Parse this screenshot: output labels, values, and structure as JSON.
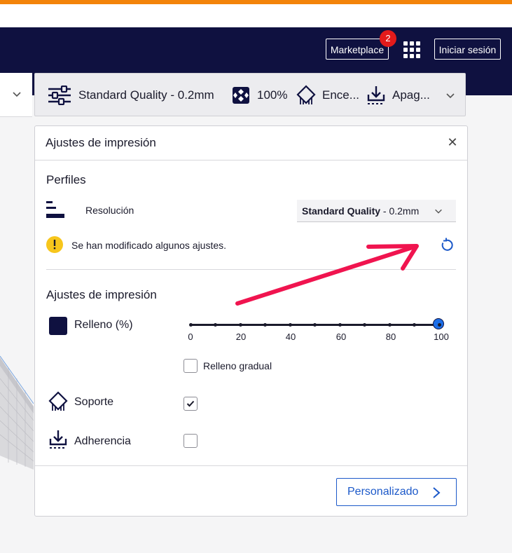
{
  "header": {
    "marketplace_label": "Marketplace",
    "marketplace_badge": "2",
    "signin_label": "Iniciar sesión"
  },
  "toolbar": {
    "profile": "Standard Quality - 0.2mm",
    "infill": "100%",
    "support": "Ence...",
    "adhesion": "Apag..."
  },
  "panel": {
    "title": "Ajustes de impresión",
    "profiles_title": "Perfiles",
    "resolution_label": "Resolución",
    "resolution_value_bold": "Standard Quality",
    "resolution_value_rest": " - 0.2mm",
    "warning_text": "Se han modificado algunos ajustes.",
    "print_settings_title": "Ajustes de impresión",
    "infill_label": "Relleno (%)",
    "infill_value": 100,
    "infill_ticks": [
      "0",
      "20",
      "40",
      "60",
      "80",
      "100"
    ],
    "gradual_infill_label": "Relleno gradual",
    "gradual_infill_checked": false,
    "support_label": "Soporte",
    "support_checked": true,
    "adhesion_label": "Adherencia",
    "adhesion_checked": false,
    "custom_button": "Personalizado"
  },
  "colors": {
    "orange": "#f3840a",
    "navy": "#0f1140",
    "accent_blue": "#1c59c9",
    "annotation_arrow": "#f0144f",
    "warning_yellow": "#f7c61c"
  },
  "icons": [
    "sliders-icon",
    "infill-icon",
    "support-icon",
    "adhesion-icon",
    "warning-icon",
    "reset-icon",
    "close-icon",
    "chevron-down-icon",
    "chevron-right-icon",
    "apps-grid-icon",
    "resolution-icon"
  ]
}
